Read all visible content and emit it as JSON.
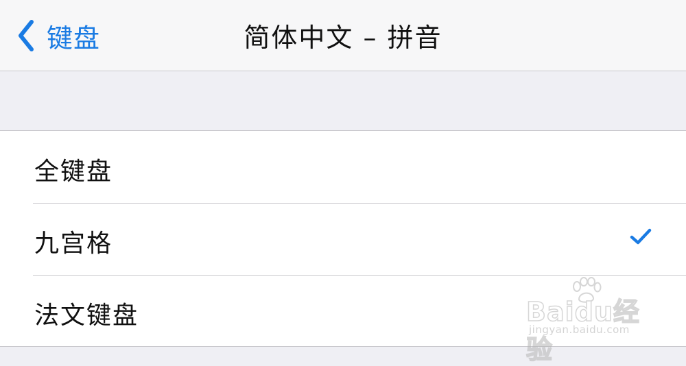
{
  "navbar": {
    "back_label": "键盘",
    "title": "简体中文 – 拼音"
  },
  "keyboard_options": [
    {
      "label": "全键盘",
      "selected": false
    },
    {
      "label": "九宫格",
      "selected": true
    },
    {
      "label": "法文键盘",
      "selected": false
    }
  ],
  "watermark": {
    "brand": "Baidu经验",
    "url": "jingyan.baidu.com"
  },
  "colors": {
    "accent": "#1a7be3",
    "background": "#efeff4",
    "separator": "#c8c7cc"
  },
  "icons": {
    "back": "chevron-left-icon",
    "selected": "checkmark-icon",
    "watermark": "paw-icon"
  }
}
